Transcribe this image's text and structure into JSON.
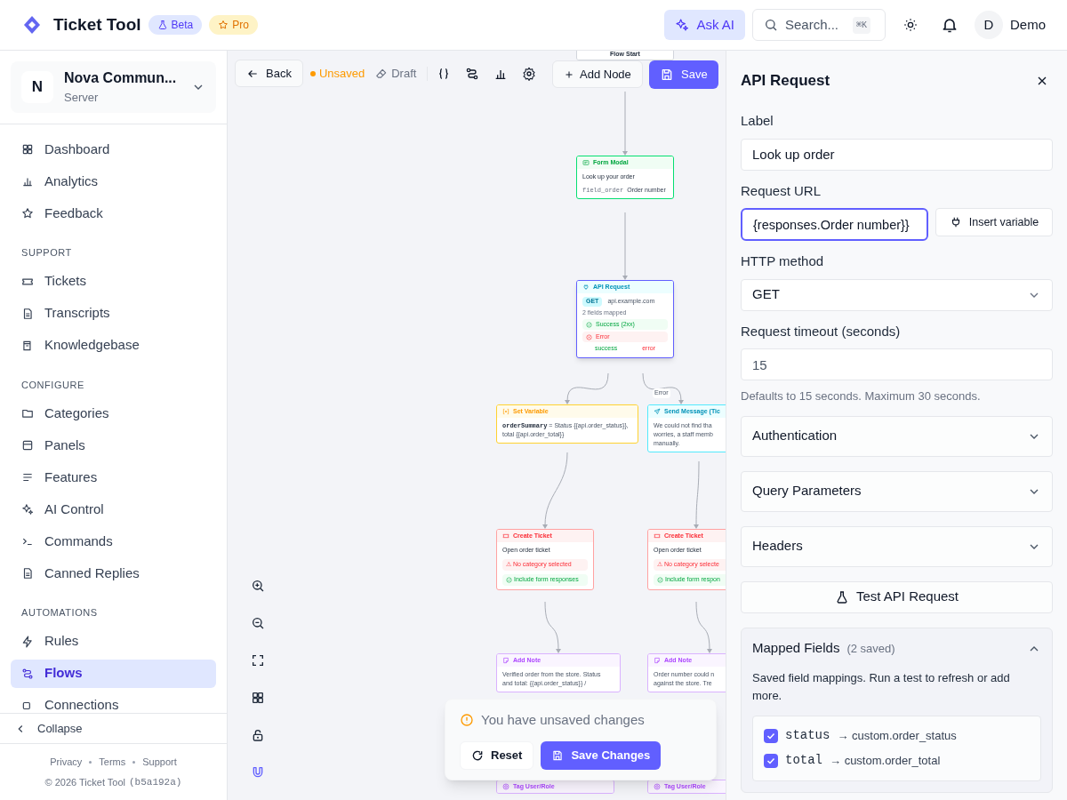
{
  "header": {
    "app_name": "Ticket Tool",
    "badges": [
      {
        "kind": "beta",
        "label": "Beta"
      },
      {
        "kind": "pro",
        "label": "Pro"
      }
    ],
    "ask_ai": "Ask AI",
    "search": {
      "placeholder": "Search...",
      "shortcut": "⌘K"
    },
    "user": {
      "initial": "D",
      "name": "Demo"
    }
  },
  "sidebar": {
    "server": {
      "initial": "N",
      "name": "Nova Commun...",
      "subtitle": "Server"
    },
    "groups": [
      {
        "items": [
          {
            "label": "Dashboard",
            "selected": false
          },
          {
            "label": "Analytics",
            "selected": false
          },
          {
            "label": "Feedback",
            "selected": false
          }
        ]
      },
      {
        "heading": "SUPPORT",
        "items": [
          {
            "label": "Tickets",
            "selected": false
          },
          {
            "label": "Transcripts",
            "selected": false
          },
          {
            "label": "Knowledgebase",
            "selected": false
          }
        ]
      },
      {
        "heading": "CONFIGURE",
        "items": [
          {
            "label": "Categories",
            "selected": false
          },
          {
            "label": "Panels",
            "selected": false
          },
          {
            "label": "Features",
            "selected": false
          },
          {
            "label": "AI Control",
            "selected": false
          },
          {
            "label": "Commands",
            "selected": false
          },
          {
            "label": "Canned Replies",
            "selected": false
          }
        ]
      },
      {
        "heading": "AUTOMATIONS",
        "items": [
          {
            "label": "Rules",
            "selected": false
          },
          {
            "label": "Flows",
            "selected": true
          },
          {
            "label": "Connections",
            "selected": false
          }
        ]
      }
    ],
    "collapse": "Collapse",
    "footer_links": [
      "Privacy",
      "Terms",
      "Support"
    ],
    "copyright": "© 2026 Ticket Tool",
    "build": "(b5a192a)"
  },
  "toolbar": {
    "back": "Back",
    "save_state": "Unsaved",
    "status": "Draft",
    "add_node": "Add Node",
    "save": "Save"
  },
  "nodes": [
    {
      "kind": "start",
      "title": "Flow Start",
      "selected": false
    },
    {
      "kind": "form",
      "title": "Form Modal",
      "selected": false,
      "heading": "Look up your order",
      "field_key": "field_order",
      "field_label": "Order number"
    },
    {
      "kind": "api",
      "title": "API Request",
      "selected": true,
      "method": "GET",
      "url": "api.example.com",
      "note": "2 fields mapped",
      "outcomes": [
        {
          "kind": "success",
          "label": "Success (2xx)"
        },
        {
          "kind": "error",
          "label": "Error"
        }
      ],
      "handles": [
        {
          "kind": "success",
          "label": "success"
        },
        {
          "kind": "error",
          "label": "error"
        }
      ]
    },
    {
      "kind": "setvar",
      "title": "Set Variable",
      "selected": false,
      "var_name": "orderSummary",
      "value": "= Status {{api.order_status}}, total {{api.order_total}}"
    },
    {
      "kind": "send",
      "title": "Send Message (Tic",
      "selected": false,
      "lines": [
        "We could not find tha",
        "worries, a staff memb",
        "manually."
      ]
    },
    {
      "kind": "ticket",
      "title": "Create Ticket",
      "selected": false,
      "heading": "Open order ticket",
      "warning": "⚠ No category selected",
      "option": "Include form responses"
    },
    {
      "kind": "ticket",
      "title": "Create Ticket",
      "selected": false,
      "heading": "Open order ticket",
      "warning": "⚠ No category selecte",
      "option": "Include form respon"
    },
    {
      "kind": "note",
      "title": "Add Note",
      "selected": false,
      "lines": [
        "Verified order from the store. Status",
        "and total: {{api.order_status}} /"
      ]
    },
    {
      "kind": "note",
      "title": "Add Note",
      "selected": false,
      "lines": [
        "Order number could n",
        "against the store. Tre"
      ]
    },
    {
      "kind": "tag",
      "title": "Tag User/Role",
      "selected": false
    },
    {
      "kind": "tag",
      "title": "Tag User/Role",
      "selected": false
    }
  ],
  "edge_label": "Error",
  "toast": {
    "message": "You have unsaved changes",
    "reset": "Reset",
    "save": "Save Changes"
  },
  "panel": {
    "title": "API Request",
    "label": {
      "label": "Label",
      "value": "Look up order"
    },
    "url": {
      "label": "Request URL",
      "value": "{responses.Order number}}",
      "insert": "Insert variable"
    },
    "method": {
      "label": "HTTP method",
      "value": "GET"
    },
    "timeout": {
      "label": "Request timeout (seconds)",
      "value": "15",
      "help": "Defaults to 15 seconds. Maximum 30 seconds."
    },
    "sections": [
      {
        "title": "Authentication",
        "expanded": false
      },
      {
        "title": "Query Parameters",
        "expanded": false
      },
      {
        "title": "Headers",
        "expanded": false
      }
    ],
    "test_button": "Test API Request",
    "mapped": {
      "title": "Mapped Fields",
      "count": "(2 saved)",
      "expanded": true,
      "hint": "Saved field mappings. Run a test to refresh or add more.",
      "rows": [
        {
          "key": "status",
          "target": "→ custom.order_status",
          "checked": true
        },
        {
          "key": "total",
          "target": "→ custom.order_total",
          "checked": true
        }
      ]
    }
  }
}
